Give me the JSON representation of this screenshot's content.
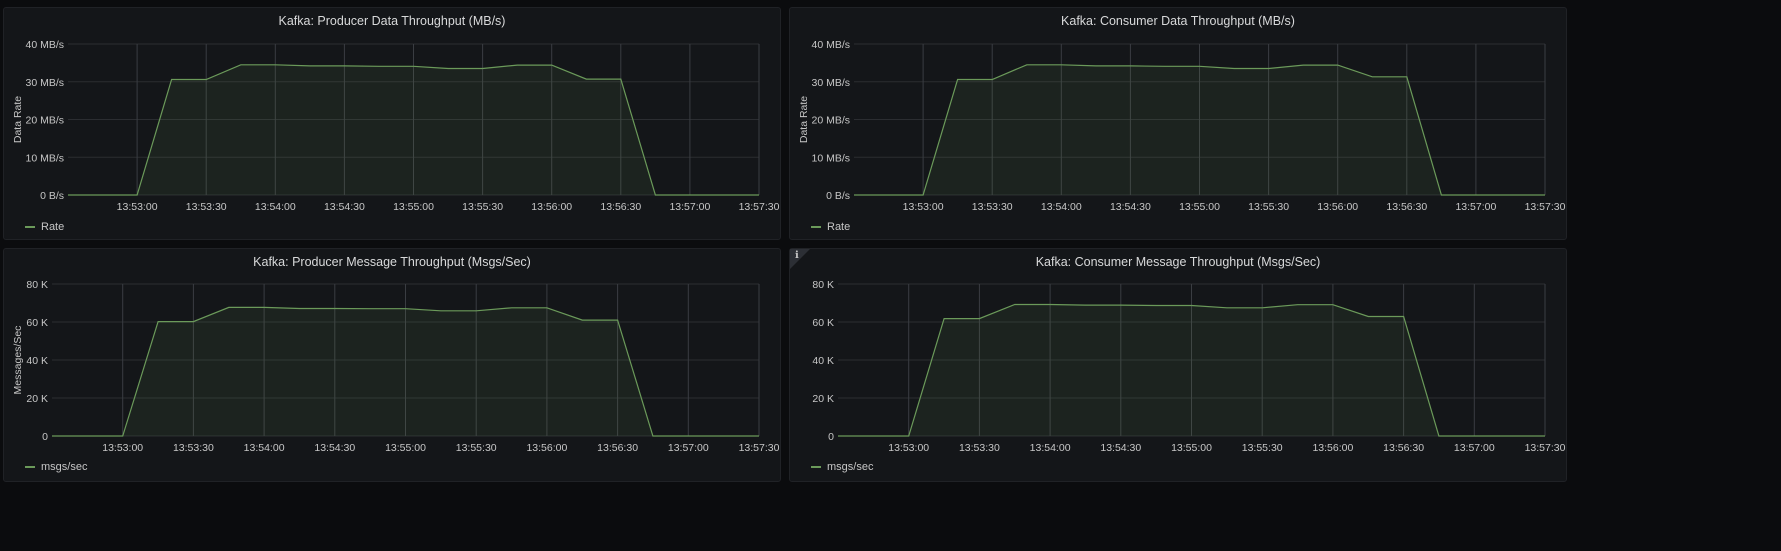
{
  "colors": {
    "series": "#6b9a5a",
    "fill": "#6b9a5a",
    "grid": "#2b2d31",
    "vgrid": "#3a3d42"
  },
  "x_ticks": [
    "13:53:00",
    "13:53:30",
    "13:54:00",
    "13:54:30",
    "13:55:00",
    "13:55:30",
    "13:56:00",
    "13:56:30",
    "13:57:00",
    "13:57:30"
  ],
  "chart_data": [
    {
      "type": "area",
      "title": "Kafka: Producer Data Throughput (MB/s)",
      "ylabel": "Data Rate",
      "y_ticks": [
        "0 B/s",
        "10 MB/s",
        "20 MB/s",
        "30 MB/s",
        "40 MB/s"
      ],
      "ylim": [
        0,
        40
      ],
      "x_range": [
        "13:52:30",
        "13:57:30"
      ],
      "series": [
        {
          "name": "Rate",
          "x": [
            "13:52:30",
            "13:53:00",
            "13:53:15",
            "13:53:30",
            "13:53:45",
            "13:54:00",
            "13:54:15",
            "13:54:30",
            "13:54:45",
            "13:55:00",
            "13:55:15",
            "13:55:30",
            "13:55:45",
            "13:56:00",
            "13:56:15",
            "13:56:30",
            "13:56:45",
            "13:57:00",
            "13:57:15",
            "13:57:30"
          ],
          "values": [
            0,
            0,
            30.6,
            30.6,
            34.5,
            34.5,
            34.2,
            34.2,
            34.1,
            34.1,
            33.5,
            33.5,
            34.4,
            34.4,
            30.7,
            30.7,
            0,
            0,
            0,
            0
          ]
        }
      ]
    },
    {
      "type": "area",
      "title": "Kafka: Consumer Data Throughput (MB/s)",
      "ylabel": "Data Rate",
      "y_ticks": [
        "0 B/s",
        "10 MB/s",
        "20 MB/s",
        "30 MB/s",
        "40 MB/s"
      ],
      "ylim": [
        0,
        40
      ],
      "x_range": [
        "13:52:30",
        "13:57:30"
      ],
      "series": [
        {
          "name": "Rate",
          "x": [
            "13:52:30",
            "13:53:00",
            "13:53:15",
            "13:53:30",
            "13:53:45",
            "13:54:00",
            "13:54:15",
            "13:54:30",
            "13:54:45",
            "13:55:00",
            "13:55:15",
            "13:55:30",
            "13:55:45",
            "13:56:00",
            "13:56:15",
            "13:56:30",
            "13:56:45",
            "13:57:00",
            "13:57:15",
            "13:57:30"
          ],
          "values": [
            0,
            0,
            30.6,
            30.6,
            34.5,
            34.5,
            34.2,
            34.2,
            34.1,
            34.1,
            33.5,
            33.5,
            34.4,
            34.4,
            31.3,
            31.3,
            0,
            0,
            0,
            0
          ]
        }
      ]
    },
    {
      "type": "area",
      "title": "Kafka: Producer Message Throughput (Msgs/Sec)",
      "ylabel": "Messages/Sec",
      "y_ticks": [
        "0",
        "20 K",
        "40 K",
        "60 K",
        "80 K"
      ],
      "ylim": [
        0,
        80000
      ],
      "x_range": [
        "13:52:30",
        "13:57:30"
      ],
      "series": [
        {
          "name": "msgs/sec",
          "x": [
            "13:52:30",
            "13:53:00",
            "13:53:15",
            "13:53:30",
            "13:53:45",
            "13:54:00",
            "13:54:15",
            "13:54:30",
            "13:54:45",
            "13:55:00",
            "13:55:15",
            "13:55:30",
            "13:55:45",
            "13:56:00",
            "13:56:15",
            "13:56:30",
            "13:56:45",
            "13:57:00",
            "13:57:15",
            "13:57:30"
          ],
          "values": [
            0,
            0,
            60200,
            60200,
            67700,
            67700,
            67100,
            67100,
            67000,
            67000,
            65900,
            65900,
            67500,
            67500,
            61000,
            61000,
            0,
            0,
            0,
            0
          ]
        }
      ]
    },
    {
      "type": "area",
      "title": "Kafka: Consumer Message Throughput (Msgs/Sec)",
      "ylabel": "",
      "y_ticks": [
        "0",
        "20 K",
        "40 K",
        "60 K",
        "80 K"
      ],
      "ylim": [
        0,
        80000
      ],
      "x_range": [
        "13:52:30",
        "13:57:30"
      ],
      "series": [
        {
          "name": "msgs/sec",
          "x": [
            "13:52:30",
            "13:53:00",
            "13:53:15",
            "13:53:30",
            "13:53:45",
            "13:54:00",
            "13:54:15",
            "13:54:30",
            "13:54:45",
            "13:55:00",
            "13:55:15",
            "13:55:30",
            "13:55:45",
            "13:56:00",
            "13:56:15",
            "13:56:30",
            "13:56:45",
            "13:57:00",
            "13:57:15",
            "13:57:30"
          ],
          "values": [
            0,
            0,
            61800,
            61800,
            69200,
            69200,
            68900,
            68900,
            68700,
            68700,
            67500,
            67500,
            69100,
            69100,
            62900,
            62900,
            0,
            0,
            0,
            0
          ]
        }
      ]
    }
  ],
  "info_icon": "info-icon"
}
